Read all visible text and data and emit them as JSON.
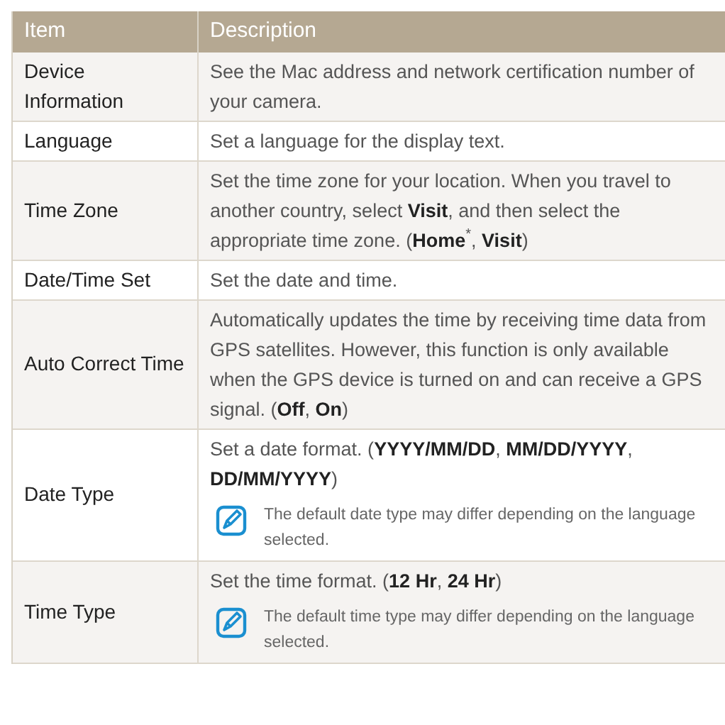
{
  "table": {
    "columns": [
      "Item",
      "Description"
    ],
    "rows": [
      {
        "item": "Device Information",
        "description": "See the Mac address and network certification number of your camera.",
        "shaded": true
      },
      {
        "item": "Language",
        "description": "Set a language for the display text.",
        "shaded": false
      },
      {
        "item": "Time Zone",
        "description": "Set the time zone for your location. When you travel to another country, select **Visit**, and then select the appropriate time zone. (**Home**$^{*}$, **Visit**)",
        "shaded": true
      },
      {
        "item": "Date/Time Set",
        "description": "Set the date and time.",
        "shaded": false
      },
      {
        "item": "Auto Correct Time",
        "description": "Automatically updates the time by receiving time data from GPS satellites. However, this function is only available when the GPS device is turned on and can receive a GPS signal. (**Off**, **On**)",
        "shaded": true
      },
      {
        "item": "Date Type",
        "description": "Set a date format. (**YYYY/MM/DD**, **MM/DD/YYYY**, **DD/MM/YYYY**)",
        "note": "The default date type may differ depending on the language selected.",
        "shaded": false
      },
      {
        "item": "Time Type",
        "description": "Set the time format. (**12 Hr**, **24 Hr**)",
        "note": "The default time type may differ depending on the language selected.",
        "shaded": true
      }
    ]
  }
}
